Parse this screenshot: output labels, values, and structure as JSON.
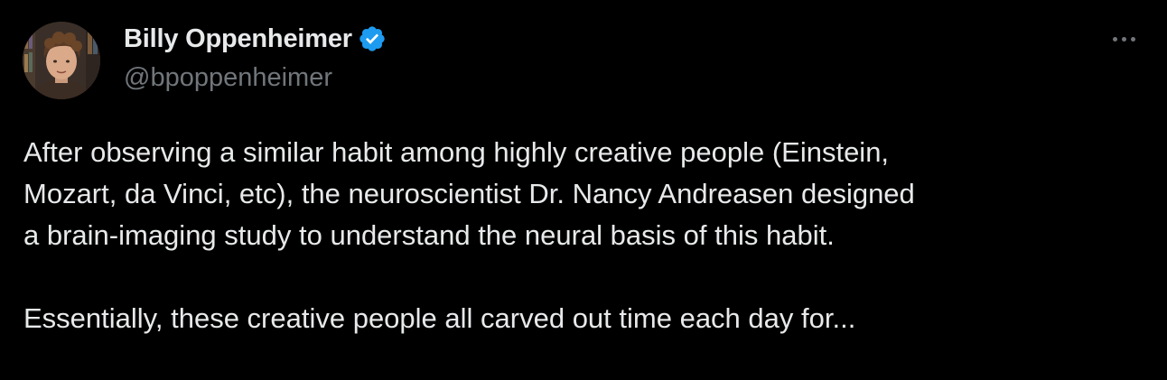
{
  "tweet": {
    "author": {
      "display_name": "Billy Oppenheimer",
      "handle": "@bpoppenheimer",
      "verified": true
    },
    "text": {
      "paragraphs": [
        "After observing a similar habit among highly creative people (Einstein,\nMozart, da Vinci, etc), the neuroscientist Dr. Nancy Andreasen designed\na brain-imaging study to understand the neural basis of this habit.",
        "Essentially, these creative people all carved out time each day for..."
      ]
    }
  },
  "colors": {
    "background": "#000000",
    "text_primary": "#e7e9ea",
    "text_secondary": "#71767b",
    "verified_badge": "#1d9bf0"
  },
  "icons": {
    "verified": "verified-badge-icon",
    "more": "more-horizontal-icon"
  }
}
